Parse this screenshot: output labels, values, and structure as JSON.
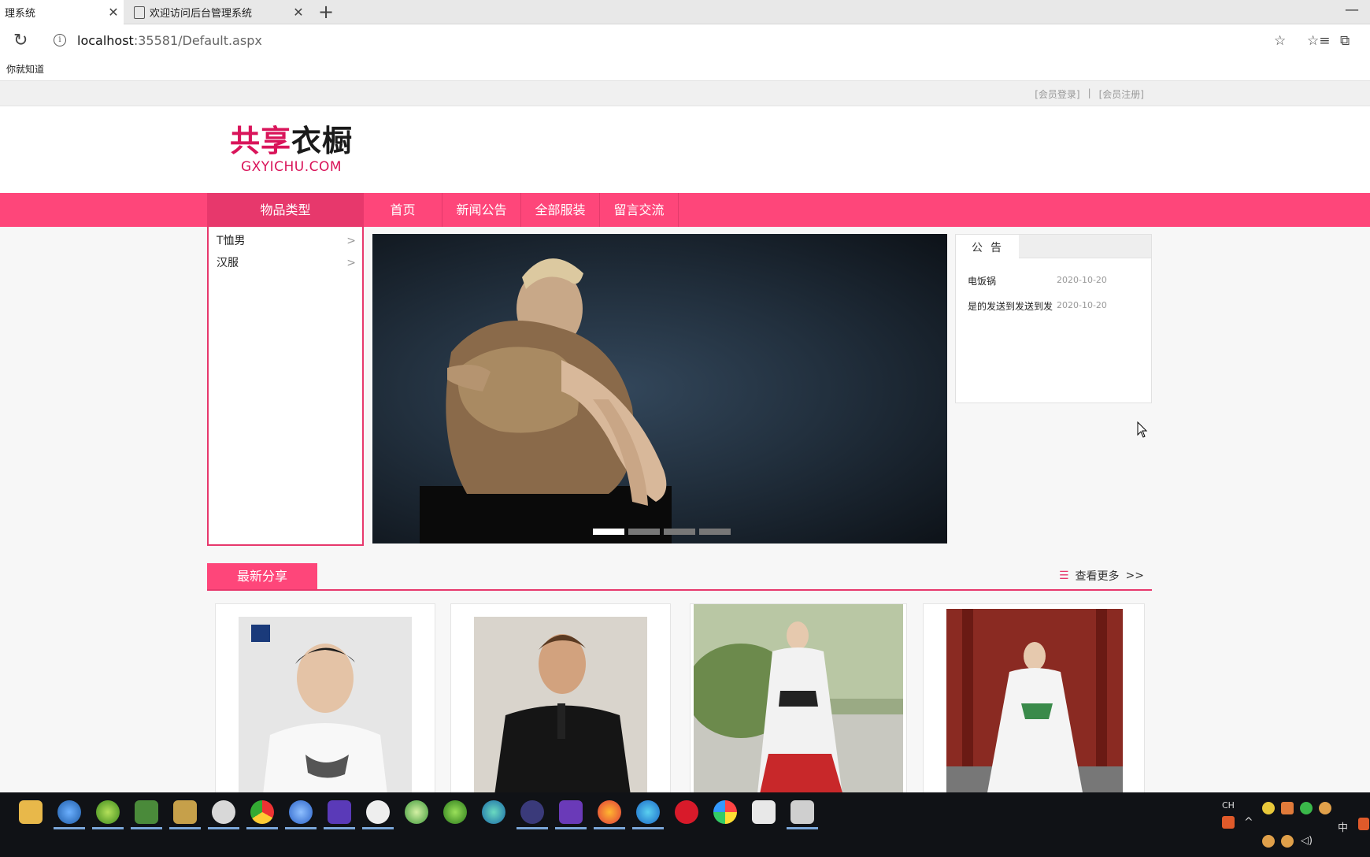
{
  "browser": {
    "tabs": [
      {
        "title": "理系统",
        "close": "✕"
      },
      {
        "title": "欢迎访问后台管理系统",
        "close": "✕"
      }
    ],
    "new_tab": "+",
    "minimize": "—",
    "reload_icon": "↻",
    "url_host": "localhost",
    "url_path": ":35581/Default.aspx",
    "favorites": [
      "你就知道"
    ]
  },
  "site": {
    "top_links": [
      "[会员登录]",
      "|",
      "[会员注册]"
    ],
    "logo_cn_pink": "共享",
    "logo_cn_dark": "衣橱",
    "logo_en": "GXYICHU.COM",
    "nav_category": "物品类型",
    "nav_items": [
      "首页",
      "新闻公告",
      "全部服装",
      "留言交流"
    ],
    "categories": [
      {
        "label": "T恤男",
        "chevron": ">"
      },
      {
        "label": "汉服",
        "chevron": ">"
      }
    ],
    "notice": {
      "title": "公告",
      "items": [
        {
          "title": "电饭锅",
          "date": "2020-10-20"
        },
        {
          "title": "是的发送到发送到发",
          "date": "2020-10-20"
        }
      ]
    },
    "latest": {
      "label": "最新分享",
      "more": "查看更多",
      "more_icon": ">>"
    },
    "banner_dots": 4,
    "banner_active_dot": 0
  },
  "taskbar": {
    "ime": "CH",
    "lang": "中"
  }
}
